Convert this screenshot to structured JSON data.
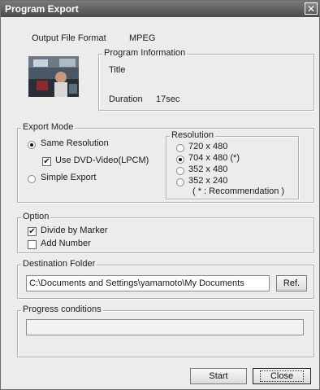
{
  "window": {
    "title": "Program Export",
    "close_glyph": "✕"
  },
  "format": {
    "label": "Output File Format",
    "value": "MPEG"
  },
  "program_info": {
    "legend": "Program Information",
    "title_label": "Title",
    "title_value": "",
    "duration_label": "Duration",
    "duration_value": "17sec"
  },
  "export_mode": {
    "legend": "Export Mode",
    "same_resolution": "Same Resolution",
    "use_dvd": "Use DVD-Video(LPCM)",
    "simple_export": "Simple Export",
    "selected": "same_resolution",
    "use_dvd_checked": true
  },
  "resolution": {
    "legend": "Resolution",
    "options": [
      "720 x 480",
      "704 x 480  (*)",
      "352 x 480",
      "352 x 240"
    ],
    "selected_index": 1,
    "note": "( * : Recommendation )"
  },
  "option": {
    "legend": "Option",
    "divide_by_marker": "Divide by Marker",
    "divide_checked": true,
    "add_number": "Add Number",
    "add_number_checked": false
  },
  "destination": {
    "legend": "Destination Folder",
    "path": "C:\\Documents and Settings\\yamamoto\\My Documents",
    "ref_label": "Ref."
  },
  "progress": {
    "legend": "Progress conditions",
    "percent": 0
  },
  "buttons": {
    "start": "Start",
    "close": "Close"
  },
  "icons": {
    "close": "close-icon",
    "check": "✔"
  }
}
